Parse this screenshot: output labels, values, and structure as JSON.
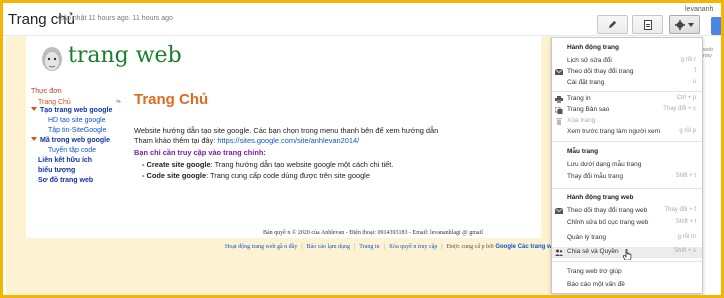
{
  "header": {
    "site_title": "Trang chủ",
    "updated": "Cập nhật 11 hours ago. 11 hours ago",
    "user": "levananh"
  },
  "site": {
    "name": "trang web",
    "page_heading": "Trang Chủ"
  },
  "nav": {
    "title": "Thực đơn",
    "items": [
      "Trang Chủ",
      "Tạo trang web google",
      "HD tạo site google",
      "Tập tin-SiteGoogle",
      "Mã trong web google",
      "Tuyển tập code",
      "Liên kết hữu ích",
      "biểu tượng",
      "Sơ đồ trang web"
    ]
  },
  "content": {
    "line1": "Website hướng dẫn tạo site google.  Các bạn chọn trong menu thanh bên để xem hướng dẫn",
    "line2_prefix": "Tham khảo thêm tại đây:  ",
    "line2_link": "https://sites.google.com/site/anhlevan2014/",
    "question": "Bạn chỉ cần truy cập vào trang chính:",
    "bullet1_label": "- Create site google",
    "bullet1_text": ": Trang hướng dẫn tạo website google một cách chi tiết.",
    "bullet2_label": "- Code site google",
    "bullet2_text": ":   Trang cung cấp code dùng được trên site google"
  },
  "footer": {
    "copyright": "Bản quyề n © 2020 của Anhlevan - Điện thoại: 0914393183 - Email: levananhlagi @ gmail",
    "links": [
      "Hoạt động trang web gầ n đây",
      "Báo cáo lạm dụng",
      "Trang in",
      "Xóa quyề n truy cập"
    ],
    "powered_prefix": "Được cung cấ p bởi",
    "powered_link": "Google Các trang web"
  },
  "dropdown": {
    "sections": [
      {
        "header": "Hành động trang",
        "items": [
          {
            "label": "Lịch sử sửa đổi",
            "shortcut": "g rồi r",
            "icon": "",
            "disabled": false
          },
          {
            "label": "Theo dõi thay đổi trang",
            "shortcut": "f",
            "icon": "mail-icon",
            "disabled": false
          },
          {
            "label": "Cài đặt trang",
            "shortcut": "u",
            "icon": "",
            "disabled": false
          },
          {
            "label": "Trang in",
            "shortcut": "Ctrl + p",
            "icon": "printer-icon",
            "disabled": false
          },
          {
            "label": "Trang Bản sao",
            "shortcut": "Thay đổi + c",
            "icon": "copy-icon",
            "disabled": false
          },
          {
            "label": "Xóa trang",
            "shortcut": "",
            "icon": "trash-icon",
            "disabled": true
          },
          {
            "label": "Xem trước trang làm người xem",
            "shortcut": "g rồi p",
            "icon": "",
            "disabled": false
          }
        ]
      },
      {
        "header": "Mẫu trang",
        "items": [
          {
            "label": "Lưu dưới dạng mẫu trang",
            "shortcut": "",
            "icon": "",
            "disabled": false
          },
          {
            "label": "Thay đổi mẫu trang",
            "shortcut": "Shift + t",
            "icon": "",
            "disabled": false
          }
        ]
      },
      {
        "header": "Hành động trang web",
        "items": [
          {
            "label": "Theo dõi thay đổi trang web",
            "shortcut": "Thay đổi + f",
            "icon": "mail-icon",
            "disabled": false
          },
          {
            "label": "Chỉnh sửa bố cục trang web",
            "shortcut": "Shift + l",
            "icon": "",
            "disabled": false
          },
          {
            "label": "Quản lý trang",
            "shortcut": "g rồi m",
            "icon": "",
            "disabled": false
          },
          {
            "label": "Chia sẻ và Quyền",
            "shortcut": "Shift + s",
            "icon": "share-people-icon",
            "disabled": false
          }
        ]
      },
      {
        "header": "",
        "items": [
          {
            "label": "Trang web trợ giúp",
            "shortcut": "",
            "icon": "",
            "disabled": false
          },
          {
            "label": "Báo cáo một vấn đề",
            "shortcut": "",
            "icon": "",
            "disabled": false
          }
        ]
      }
    ]
  },
  "right_edge": "web này"
}
